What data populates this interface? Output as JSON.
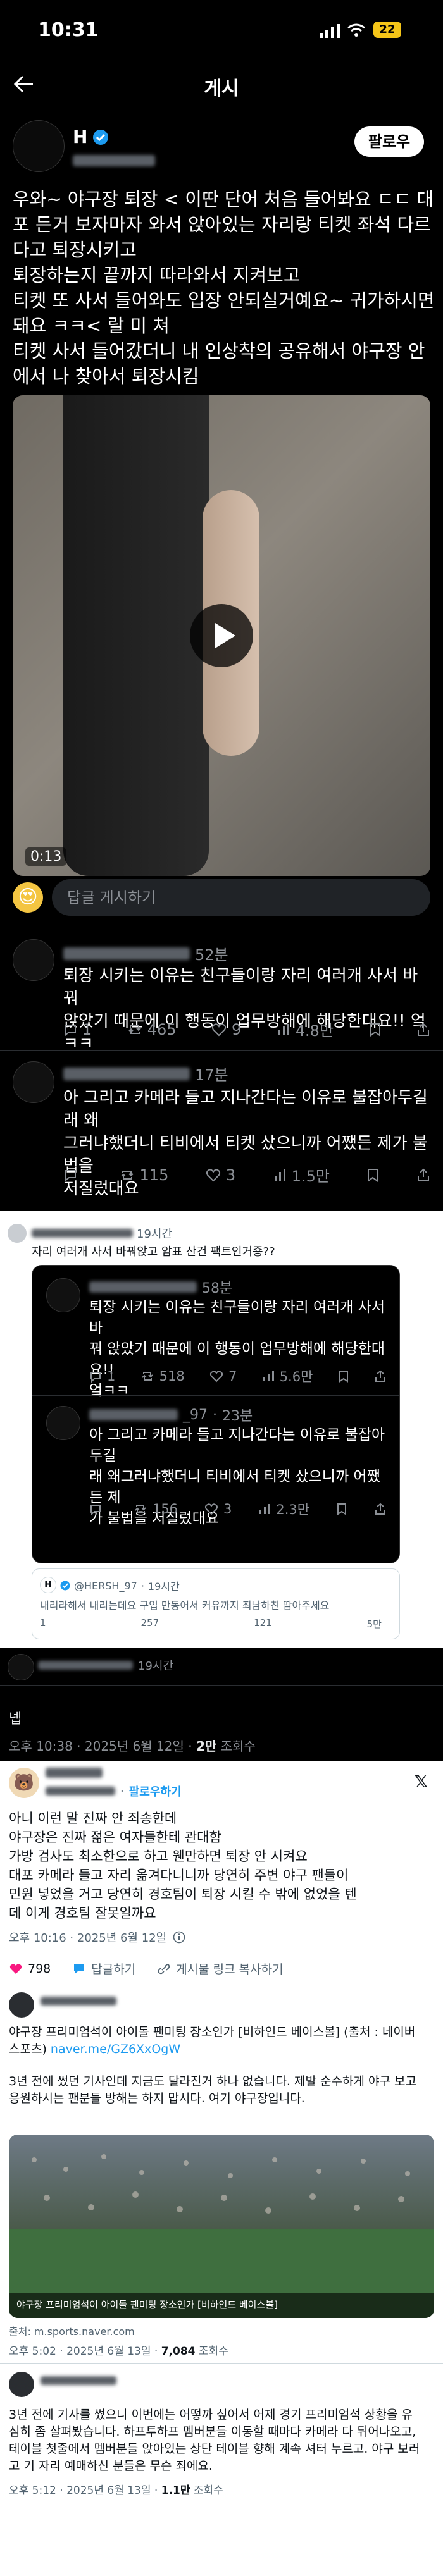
{
  "status_bar": {
    "time": "10:31",
    "battery": "22"
  },
  "nav": {
    "title": "게시",
    "follow_label": "팔로우"
  },
  "post": {
    "author_initial": "H",
    "lines": [
      "우와~ 야구장 퇴장 < 이딴 단어 처음 들어봐요 ㄷㄷ 대",
      "포 든거 보자마자 와서 앉아있는 자리랑 티켓 좌석 다르",
      "다고 퇴장시키고",
      "퇴장하는지 끝까지 따라와서 지켜보고",
      "티켓 또 사서 들어와도 입장 안되실거예요~ 귀가하시면",
      "돼요 ㅋㅋ<  랄 미 쳐",
      "티켓 사서 들어갔더니 내 인상착의 공유해서 야구장 안",
      "에서 나 찾아서 퇴장시킴"
    ],
    "video_time": "0:13",
    "reply_placeholder": "답글 게시하기"
  },
  "replies": [
    {
      "time": "52분",
      "text": [
        "퇴장 시키는 이유는 친구들이랑 자리 여러개 사서 바꿔",
        "앉았기 때문에 이 행동이 업무방해에 해당한대요!! 엌ㅋㅋ"
      ],
      "stats": {
        "reply": "1",
        "repost": "465",
        "like": "9",
        "views": "4.8만"
      }
    },
    {
      "time": "17분",
      "text": [
        "아 그리고 카메라 들고 지나간다는 이유로 불잡아두길래 왜",
        "그러냐했더니 티비에서 티켓 샀으니까 어쨌든 제가 불법을",
        "저질렀대요"
      ],
      "stats": {
        "reply": "",
        "repost": "115",
        "like": "3",
        "views": "1.5만"
      }
    }
  ],
  "quote": {
    "time": "19시간",
    "text": "자리 여러개 사서 바꿔앉고 암표 산건 팩트인거죵??",
    "inner": [
      {
        "time": "58분",
        "text": [
          "퇴장 시키는 이유는 친구들이랑 자리 여러개 사서 바",
          "꿔 앉았기 때문에 이 행동이 업무방해에 해당한대요!!",
          "엌ㅋㅋ"
        ],
        "stats": {
          "reply": "1",
          "repost": "518",
          "like": "7",
          "views": "5.6만"
        }
      },
      {
        "handle_suffix": "_97",
        "time": "23분",
        "text": [
          "아 그리고 카메라 들고 지나간다는 이유로 불잡아두길",
          "래 왜그러냐했더니 티비에서 티켓 샀으니까 어쨌든 제",
          "가 불법을 저질렀대요"
        ],
        "stats": {
          "reply": "",
          "repost": "156",
          "like": "3",
          "views": "2.3만"
        }
      }
    ],
    "nested": {
      "initial": "H",
      "handle": "@HERSH_97",
      "time": "19시간",
      "text": "내리라해서 내리는데요 구입 만동어서 커유까지 죄남하친 땀아주세요",
      "stats": {
        "reply": "1",
        "repost": "257",
        "like": "121",
        "views": "5만"
      }
    }
  },
  "reply_small": {
    "time": "19시간"
  },
  "tail": {
    "text": "넵"
  },
  "meta1": {
    "text": "오후 10:38 · 2025년 6월 12일 · ",
    "views": "2만",
    "views_label": " 조회수"
  },
  "tweet2": {
    "follow_label": "팔로우하기",
    "lines": [
      "아니 이런 말 진짜 안 죄송한데",
      "야구장은 진짜 젊은 여자들한테 관대함",
      "가방 검사도 최소한으로 하고 웬만하면 퇴장 안 시켜요",
      "대포 카메라 들고 자리 옮겨다니니까 당연히 주변 야구 팬들이",
      "민원 넣었을 거고 당연히 경호팀이 퇴장 시킬 수 밖에 없었을 텐",
      "데 이게 경호팀 잘못일까요"
    ],
    "time": "오후 10:16 · 2025년 6월 12일",
    "likes": "798",
    "reply_label": "답글하기",
    "copy_label": "게시물 링크 복사하기"
  },
  "tweet3": {
    "line1": "야구장 프리미엄석이 아이돌 팬미팅 장소인가 [비하인드 베이스볼] (출처 : 네이버",
    "line2": "스포츠) ",
    "link": "naver.me/GZ6XxOgW",
    "body": [
      "3년 전에 썼던 기사인데 지금도 달라진거 하나 없습니다. 제발 순수하게 야구 보고",
      "응원하시는 팬분들 방해는 하지 맙시다. 여기 야구장입니다."
    ],
    "image_caption": "야구장 프리미엄석이 아이돌 팬미팅 장소인가 [비하인드 베이스볼]",
    "source": "출처: m.sports.naver.com",
    "meta": "오후 5:02 · 2025년 6월 13일 · ",
    "views": "7,084",
    "views_label": " 조회수"
  },
  "tweet4": {
    "lines": [
      "3년 전에 기사를 썼으니 이번에는 어떻까 싶어서 어제 경기 프리미엄석 상황을 유",
      "심히 좀 살펴봤습니다. 하프투하프 멤버분들 이동할 때마다 카메라 다 뒤어나오고,",
      "테이블 첫줄에서 멤버분들 앉아있는 상단 테이블 향해 계속 셔터 누르고. 야구 보러",
      "고 기 자리 예매하신 분들은 무슨 죄에요."
    ],
    "meta": "오후 5:12 · 2025년 6월 13일 · ",
    "views": "1.1만",
    "views_label": " 조회수"
  },
  "colors": {
    "accent": "#1d9bf0",
    "verified": "#1d9bf0",
    "like": "#f91880",
    "bg": "#000000"
  }
}
